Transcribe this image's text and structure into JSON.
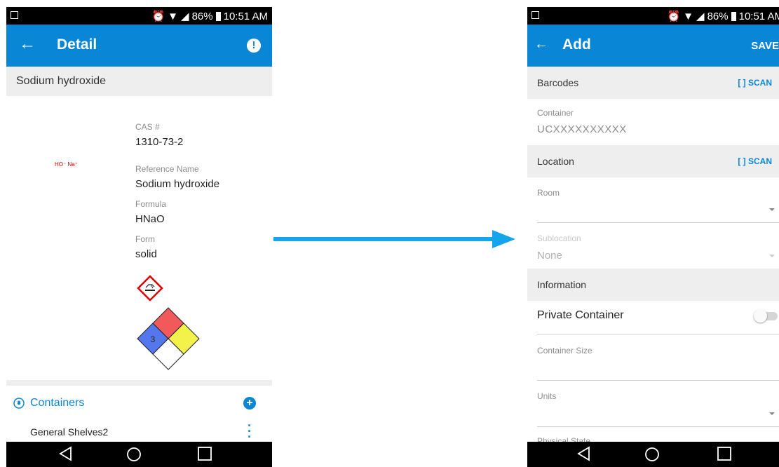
{
  "status_bar": {
    "battery": "86%",
    "time": "10:51 AM"
  },
  "detail_screen": {
    "title": "Detail",
    "compound_name": "Sodium hydroxide",
    "structure_label": "HO⁻ Na⁺",
    "fields": [
      {
        "label": "CAS #",
        "value": "1310-73-2"
      },
      {
        "label": "Reference Name",
        "value": "Sodium hydroxide"
      },
      {
        "label": "Formula",
        "value": "HNaO"
      },
      {
        "label": "Form",
        "value": "solid"
      }
    ],
    "nfpa": {
      "health": "3",
      "colors": {
        "health": "#5577ee",
        "flammability": "#f05a5a",
        "reactivity": "#f2f24a",
        "special": "#ffffff"
      }
    },
    "containers_label": "Containers",
    "container_item": "General Shelves2"
  },
  "add_screen": {
    "title": "Add",
    "save_label": "SAVE",
    "sections": {
      "barcodes": "Barcodes",
      "location": "Location",
      "information": "Information"
    },
    "scan_label": "SCAN",
    "container_label": "Container",
    "container_placeholder": "UCXXXXXXXXXX",
    "room_label": "Room",
    "sublocation_label": "Sublocation",
    "sublocation_value": "None",
    "private_container_label": "Private Container",
    "container_size_label": "Container Size",
    "units_label": "Units",
    "physical_state_label": "Physical State"
  },
  "colors": {
    "accent": "#0a86d6",
    "arrow": "#16a4ea"
  }
}
